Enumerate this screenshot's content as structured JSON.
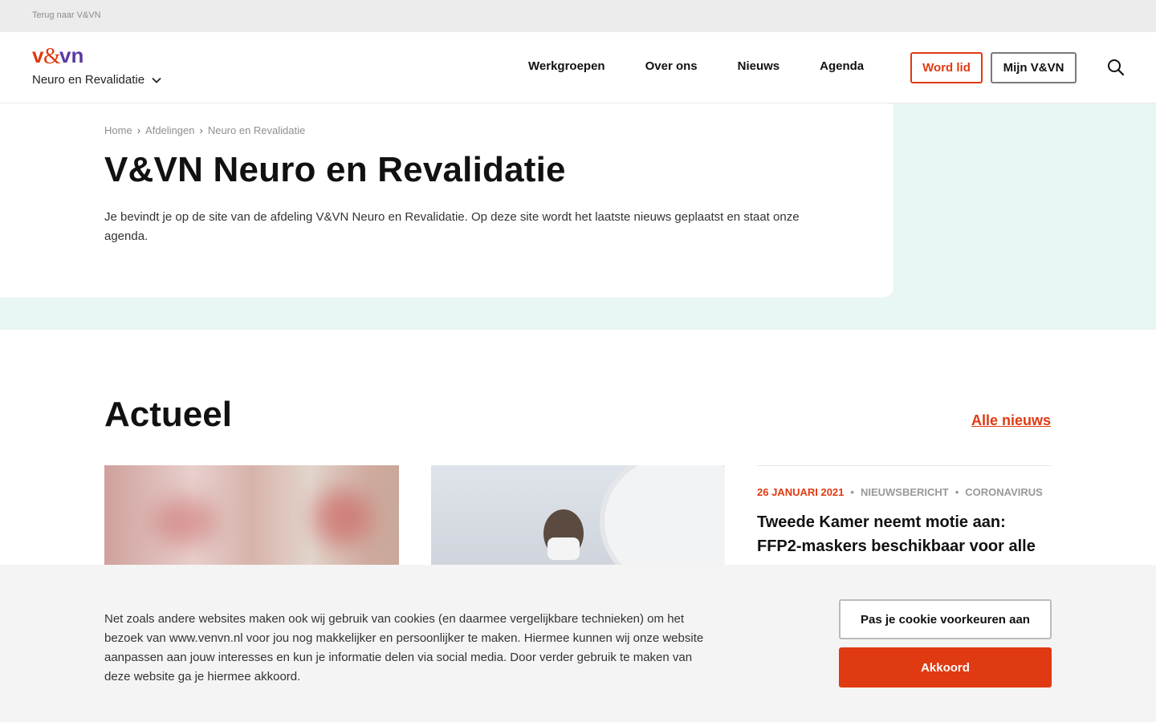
{
  "topbar": {
    "back_link": "Terug naar V&VN"
  },
  "header": {
    "logo_text": "v&vn",
    "department": "Neuro en Revalidatie",
    "nav": [
      {
        "label": "Werkgroepen"
      },
      {
        "label": "Over ons"
      },
      {
        "label": "Nieuws"
      },
      {
        "label": "Agenda"
      }
    ],
    "word_lid": "Word lid",
    "mijn": "Mijn V&VN"
  },
  "breadcrumb": [
    "Home",
    "Afdelingen",
    "Neuro en Revalidatie"
  ],
  "hero": {
    "title": "V&VN Neuro en Revalidatie",
    "text": "Je bevindt je op de site van de afdeling V&VN Neuro en Revalidatie. Op deze site wordt het laatste nieuws geplaatst en staat onze agenda."
  },
  "actueel": {
    "title": "Actueel",
    "all_link": "Alle nieuws",
    "news": {
      "date": "26 JANUARI 2021",
      "type": "NIEUWSBERICHT",
      "category": "CORONAVIRUS",
      "title": "Tweede Kamer neemt motie aan: FFP2-maskers beschikbaar voor alle"
    }
  },
  "cookie": {
    "text": "Net zoals andere websites maken ook wij gebruik van cookies (en daarmee vergelijkbare technieken) om het bezoek van www.venvn.nl voor jou nog makkelijker en persoonlijker te maken. Hiermee kunnen wij onze website aanpassen aan jouw interesses en kun je informatie delen via social media. Door verder gebruik te maken van deze website ga je hiermee akkoord.",
    "customize": "Pas je cookie voorkeuren aan",
    "accept": "Akkoord"
  },
  "colors": {
    "accent": "#e03a12",
    "hero_bg": "#e8f6f4",
    "logo_purple": "#5b3aa0"
  }
}
